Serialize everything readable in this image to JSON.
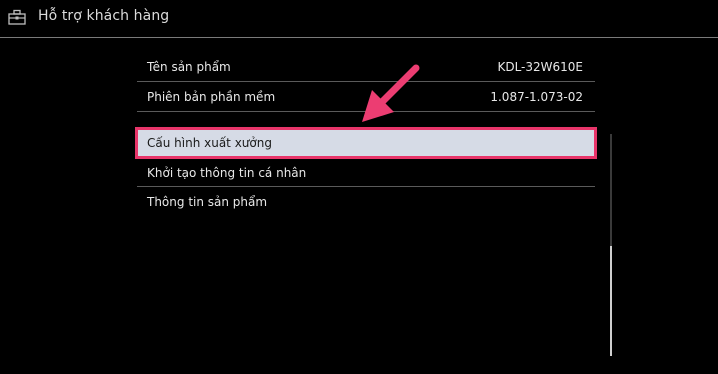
{
  "header": {
    "title": "Hỗ trợ khách hàng",
    "icon": "toolbox-icon"
  },
  "info": [
    {
      "label": "Tên sản phẩm",
      "value": "KDL-32W610E"
    },
    {
      "label": "Phiên bản phần mềm",
      "value": "1.087-1.073-02"
    }
  ],
  "menu": [
    {
      "label": "Cấu hình xuất xưởng",
      "selected": true
    },
    {
      "label": "Khởi tạo thông tin cá nhân",
      "selected": false
    },
    {
      "label": "Thông tin sản phẩm",
      "selected": false
    }
  ],
  "colors": {
    "background": "#000000",
    "highlight": "#e8356a",
    "selected_bg": "#d6dbe6"
  }
}
